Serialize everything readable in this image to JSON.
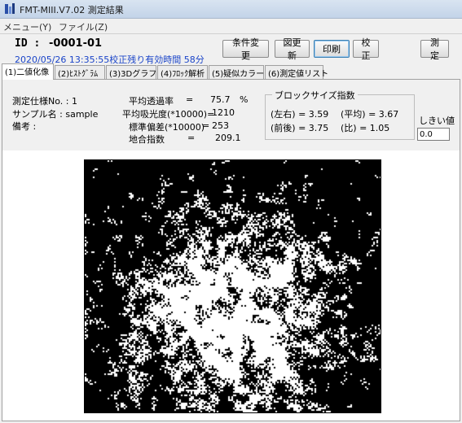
{
  "window": {
    "title": "FMT-MIII.V7.02 測定結果"
  },
  "menu": {
    "items": [
      "メニュー(Y)",
      "ファイル(Z)"
    ]
  },
  "header": {
    "id_label": "ID :",
    "id_value": "-0001-01",
    "status_line": "2020/05/26 13:35:55校正残り有効時間 58分"
  },
  "toolbar": {
    "change_conditions": "条件変更",
    "redraw": "図更新",
    "print": "印刷",
    "calibrate": "校正",
    "measure": "測定"
  },
  "tabs": [
    "(1)二値化像",
    "(2)ﾋｽﾄｸﾞﾗﾑ",
    "(3)3Dグラフ",
    "(4)ﾌﾛｯｸ解析",
    "(5)疑似カラー",
    "(6)測定値リスト"
  ],
  "info": {
    "spec_no": "測定仕様No. : 1",
    "sample_name": "サンプル名 : sample",
    "remarks": "備考 :"
  },
  "stats": {
    "avg_transmittance_label": "平均透過率",
    "avg_transmittance_eq": "=",
    "avg_transmittance_value": "75.7",
    "avg_transmittance_unit": "%",
    "avg_absorbance_label": "平均吸光度(*10000)=",
    "avg_absorbance_value": "1210",
    "std_dev_label": "標準偏差(*10000)",
    "std_dev_eq": "=",
    "std_dev_value": "253",
    "formation_index_label": "地合指数",
    "formation_index_eq": "=",
    "formation_index_value": "209.1"
  },
  "block_size": {
    "title": "ブロックサイズ指数",
    "left_right": "(左右) = 3.59",
    "average": "(平均) = 3.67",
    "front_back": "(前後) = 3.75",
    "ratio": "(比) = 1.05"
  },
  "threshold": {
    "label": "しきい値",
    "value": "0.0"
  },
  "colors": {
    "status_text": "#1a44c8",
    "image_black": "#000000",
    "image_white": "#ffffff"
  }
}
